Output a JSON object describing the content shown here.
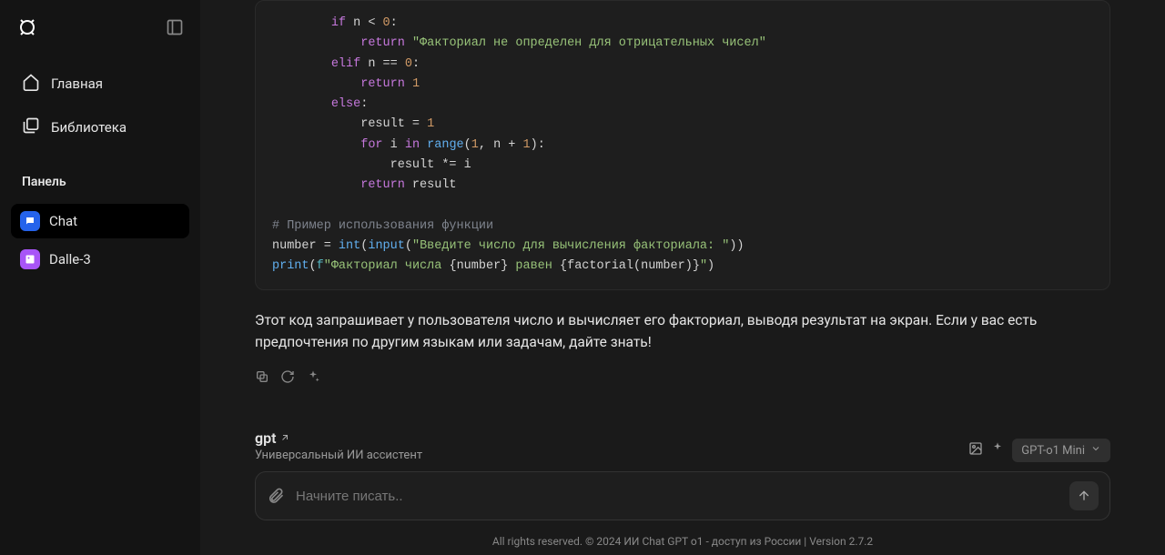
{
  "sidebar": {
    "nav": [
      {
        "label": "Главная"
      },
      {
        "label": "Библиотека"
      }
    ],
    "section_label": "Панель",
    "panels": [
      {
        "label": "Chat"
      },
      {
        "label": "Dalle-3"
      }
    ]
  },
  "code": {
    "l1_if": "if",
    "l1_rest": " n < ",
    "l1_zero": "0",
    "l1_colon": ":",
    "l2_return": "return",
    "l2_str": "\"Факториал не определен для отрицательных чисел\"",
    "l3_elif": "elif",
    "l3_rest": " n == ",
    "l3_zero": "0",
    "l3_colon": ":",
    "l4_return": "return",
    "l4_one": "1",
    "l5_else": "else",
    "l5_colon": ":",
    "l6_result": "result = ",
    "l6_one": "1",
    "l7_for": "for",
    "l7_i": " i ",
    "l7_in": "in",
    "l7_sp": " ",
    "l7_range": "range",
    "l7_open": "(",
    "l7_one": "1",
    "l7_comma": ", n + ",
    "l7_one2": "1",
    "l7_close": "):",
    "l8": "result *= i",
    "l9_return": "return",
    "l9_rest": " result",
    "comment": "# Пример использования функции",
    "l11_number": "number = ",
    "l11_int": "int",
    "l11_open": "(",
    "l11_input": "input",
    "l11_open2": "(",
    "l11_str": "\"Введите число для вычисления факториала: \"",
    "l11_close": "))",
    "l12_print": "print",
    "l12_open": "(",
    "l12_f": "f",
    "l12_str1": "\"Факториал числа ",
    "l12_brace1": "{number}",
    "l12_str2": " равен ",
    "l12_brace2": "{factorial(number)}",
    "l12_str3": "\"",
    "l12_close": ")"
  },
  "response_text": "Этот код запрашивает у пользователя число и вычисляет его факториал, выводя результат на экран. Если у вас есть предпочтения по другим языкам или задачам, дайте знать!",
  "composer": {
    "title": "gpt",
    "subtitle": "Универсальный ИИ ассистент",
    "model": "GPT-o1 Mini",
    "placeholder": "Начните писать.."
  },
  "footer": "All rights reserved. © 2024 ИИ Chat GPT o1 - доступ из России | Version 2.7.2"
}
